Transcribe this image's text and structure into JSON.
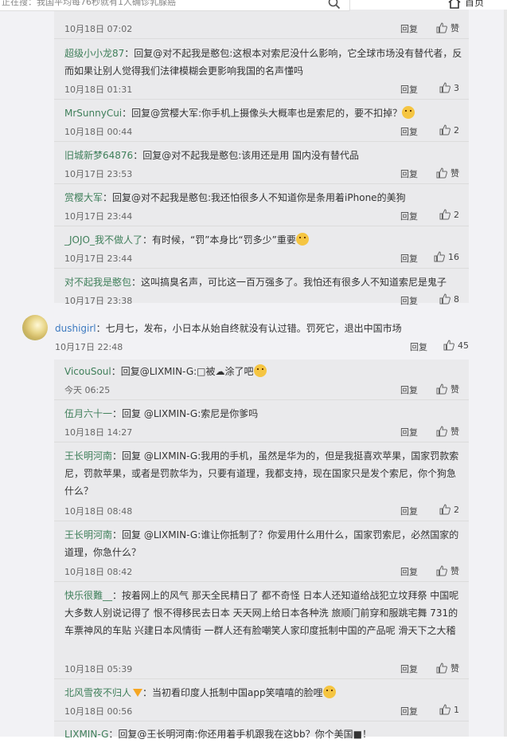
{
  "header": {
    "search_placeholder": "正在搜：我国平均每76秒就有1人确诊乳腺癌",
    "home_label": "首页"
  },
  "comments": [
    {
      "user": "",
      "text": "",
      "time": "10月18日 07:02",
      "reply": "回复",
      "likes": "赞"
    },
    {
      "user": "超级小小龙87",
      "text": "：回复@对不起我是憨包:这根本对索尼没什么影响，它全球市场没有替代者，反而如果让别人觉得我们法律模糊会更影响我国的名声懂吗",
      "time": "10月18日 01:31",
      "reply": "回复",
      "likes": "3"
    },
    {
      "user": "MrSunnyCui",
      "text": "：回复@赏樱大军:你手机上摄像头大概率也是索尼的，要不扣掉？",
      "time": "10月18日 00:44",
      "reply": "回复",
      "likes": "2"
    },
    {
      "user": "旧城新梦64876",
      "text": "：回复@对不起我是憨包:该用还是用 国内没有替代品",
      "time": "10月17日 23:53",
      "reply": "回复",
      "likes": "赞"
    },
    {
      "user": "赏樱大军",
      "text": "：回复@对不起我是憨包:我还怕很多人不知道你是条用着iPhone的美狗",
      "time": "10月17日 23:44",
      "reply": "回复",
      "likes": "2"
    },
    {
      "user": "_JOJO_我不做人了",
      "text": "：有时候，“罚”本身比“罚多少”重要",
      "time": "10月17日 23:44",
      "reply": "回复",
      "likes": "16"
    },
    {
      "user": "对不起我是憨包",
      "text": "：这叫搞臭名声，可比这一百万强多了。我怕还有很多人不知道索尼是鬼子",
      "time": "10月17日 23:38",
      "reply": "回复",
      "likes": "8"
    }
  ],
  "main_comment": {
    "user": "dushigirl",
    "text": "：七月七，发布，小日本从始自终就没有认过错。罚死它，退出中国市场",
    "time": "10月17日 22:48",
    "reply": "回复",
    "likes": "45"
  },
  "replies": [
    {
      "user": "VicouSoul",
      "text": "：回复@LIXMIN-G:□被☁涂了吧",
      "time": "今天 06:25",
      "reply": "回复",
      "likes": "赞"
    },
    {
      "user": "伍月六十一",
      "text": "：回复 @LIXMIN-G:索尼是你爹吗",
      "time": "10月18日 14:27",
      "reply": "回复",
      "likes": "赞"
    },
    {
      "user": "王长明河南",
      "text": "：回复 @LIXMIN-G:我用的手机，虽然是华为的，但是我挺喜欢苹果，国家罚款索尼，罚款苹果，或者是罚款华为，只要有道理，我都支持，现在国家只是发个索尼，你个狗急什么？",
      "time": "10月18日 08:48",
      "reply": "回复",
      "likes": "2"
    },
    {
      "user": "王长明河南",
      "text": "：回复 @LIXMIN-G:谁让你抵制了？你爱用什么用什么，国家罚索尼，必然国家的道理，你急什么？",
      "time": "10月18日 08:42",
      "reply": "回复",
      "likes": "赞"
    },
    {
      "user": "快乐很難__",
      "text": "：按着网上的风气 那天全民精日了 都不奇怪  日本人还知道给战犯立坟拜祭 中国呢 大多数人别说记得了 恨不得移民去日本 天天网上给日本各种洗 旅顺门前穿和服跳宅舞 731的车票神风的车贴 兴建日本风情街  一群人还有脸嘲笑人家印度抵制中国的产品呢 滑天下之大稽",
      "time": "10月18日 05:39",
      "reply": "回复",
      "likes": "赞"
    },
    {
      "user": "北风雪夜不归人",
      "text": "：当初看印度人抵制中国app笑嘻嘻的脸哩",
      "time": "10月18日 00:56",
      "reply": "回复",
      "likes": "1"
    },
    {
      "user": "LIXMIN-G",
      "text": "：回复@王长明河南:你还用着手机跟我在这bb？你个美国■！",
      "time": "",
      "reply": "",
      "likes": ""
    }
  ]
}
